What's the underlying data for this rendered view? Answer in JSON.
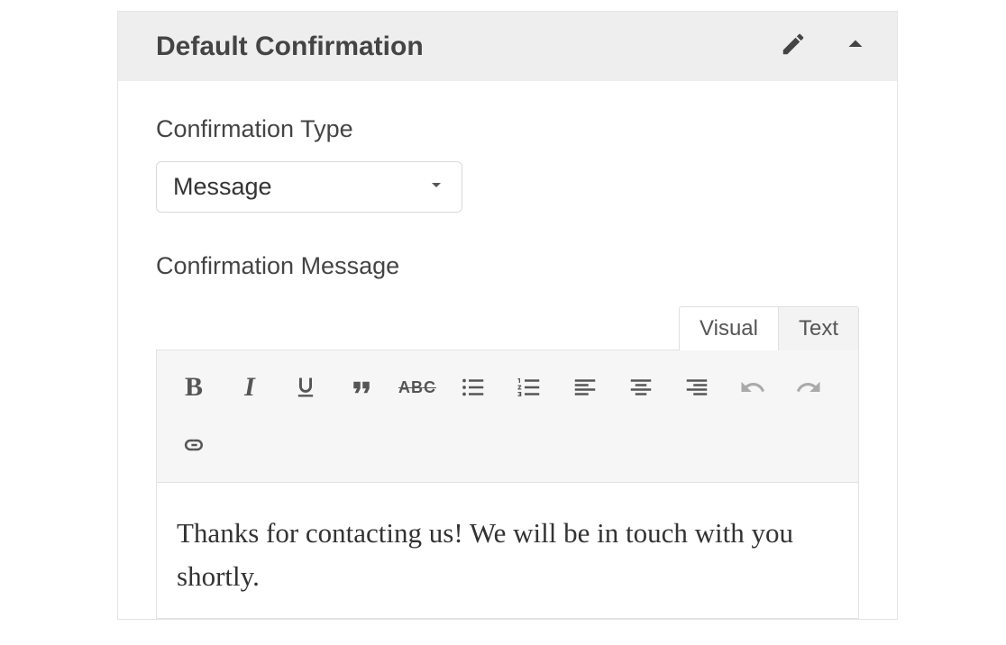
{
  "header": {
    "title": "Default Confirmation"
  },
  "form": {
    "type_label": "Confirmation Type",
    "type_value": "Message",
    "message_label": "Confirmation Message"
  },
  "editor": {
    "tabs": {
      "visual": "Visual",
      "text": "Text"
    },
    "toolbar": {
      "bold": "B",
      "italic": "I",
      "strike": "ABC"
    },
    "content": "Thanks for contacting us! We will be in touch with you shortly."
  }
}
